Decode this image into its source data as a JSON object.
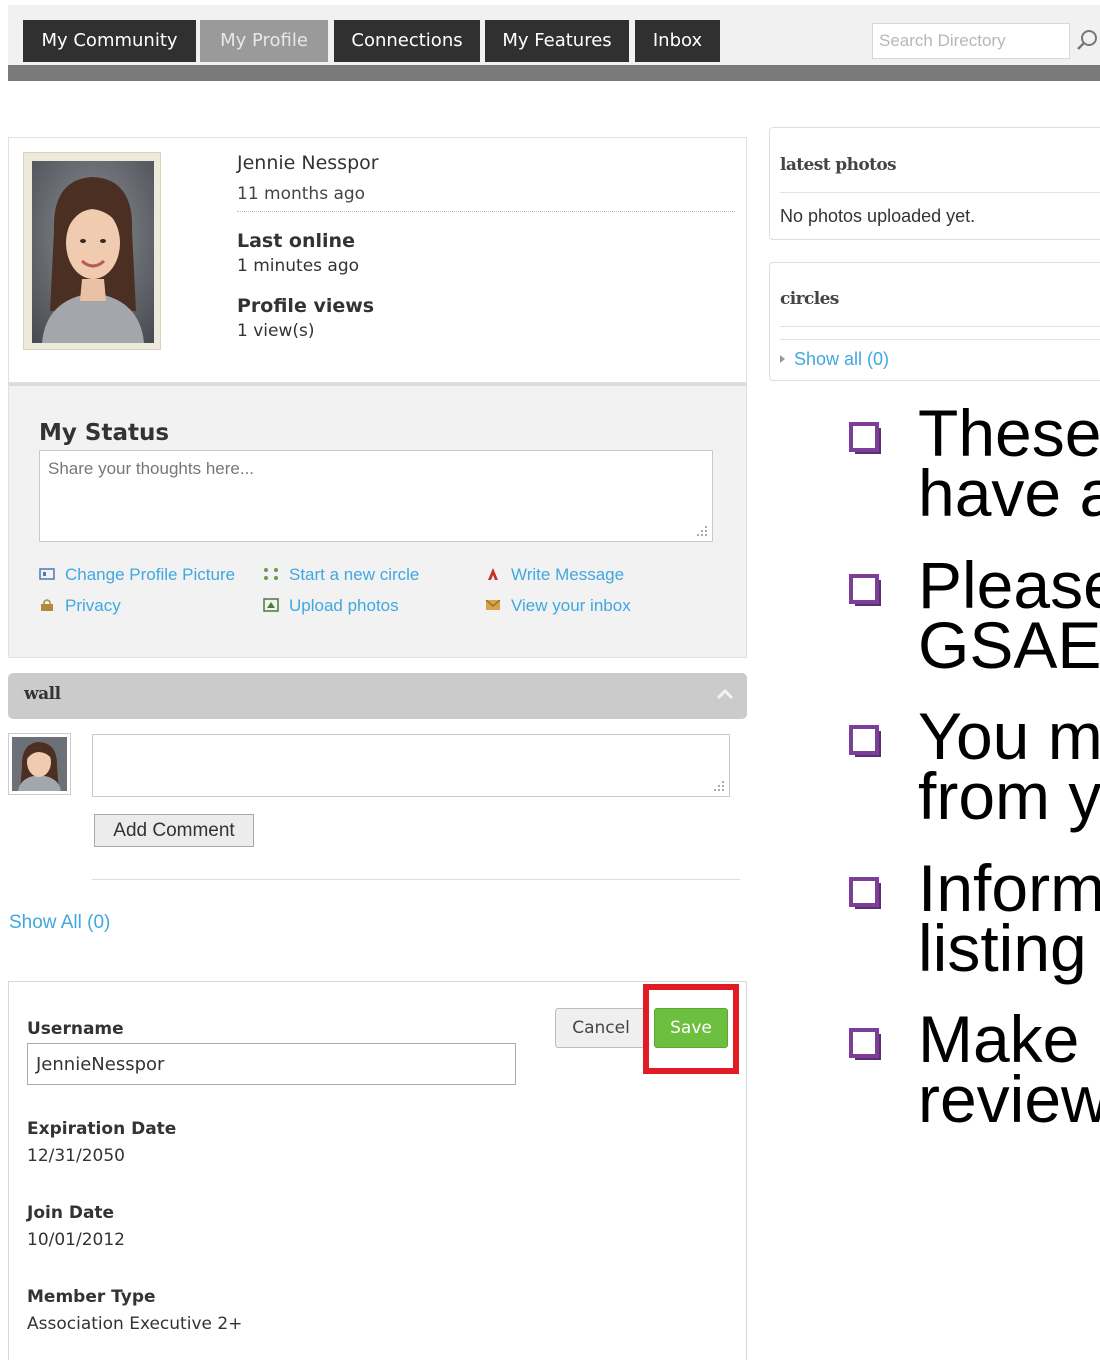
{
  "nav": {
    "tabs": [
      "My Community",
      "My Profile",
      "Connections",
      "My Features",
      "Inbox"
    ],
    "active": "My Profile",
    "search_placeholder": "Search Directory"
  },
  "profile": {
    "name": "Jennie Nesspor",
    "member_since": "11 months ago",
    "last_online_label": "Last online",
    "last_online_value": "1 minutes ago",
    "views_label": "Profile views",
    "views_value": "1 view(s)"
  },
  "status": {
    "title": "My Status",
    "placeholder": "Share your thoughts here...",
    "actions": {
      "change_picture": "Change Profile Picture",
      "new_circle": "Start a new circle",
      "write_message": "Write Message",
      "privacy": "Privacy",
      "upload_photos": "Upload photos",
      "view_inbox": "View your inbox"
    }
  },
  "wall": {
    "title": "wall",
    "add_comment": "Add Comment",
    "show_all": "Show All (0)"
  },
  "edit": {
    "username_label": "Username",
    "username_value": "JennieNesspor",
    "cancel": "Cancel",
    "save": "Save",
    "expiration_label": "Expiration Date",
    "expiration_value": "12/31/2050",
    "join_label": "Join Date",
    "join_value": "10/01/2012",
    "member_type_label": "Member Type",
    "member_type_value": "Association Executive 2+"
  },
  "sidebar": {
    "photos_title": "latest photos",
    "photos_empty": "No photos uploaded yet.",
    "circles_title": "circles",
    "circles_show_all": "Show all (0)"
  },
  "bullets": [
    [
      "These",
      "have a"
    ],
    [
      "Please",
      "GSAE"
    ],
    [
      "You m",
      "from y"
    ],
    [
      "Inform",
      "listing"
    ],
    [
      "Make",
      "review"
    ]
  ],
  "colors": {
    "link": "#40a8e0",
    "save_green": "#6cbf3f",
    "highlight_red": "#e01b24",
    "bullet_purple": "#7b3f98",
    "nav_dark": "#303030"
  }
}
